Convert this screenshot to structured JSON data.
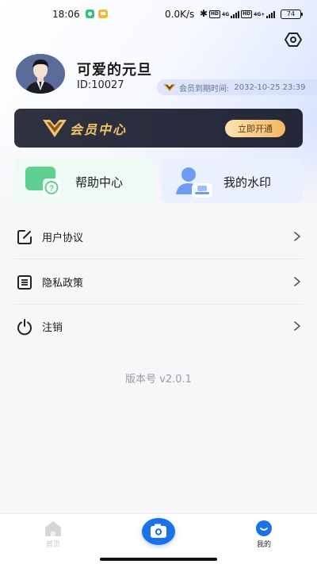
{
  "status_bar": {
    "time": "18:06",
    "network_speed": "0.0K/s",
    "bluetooth": "✱",
    "hd_label": "HD",
    "net_label_1": "4G",
    "net_label_2": "4G+",
    "battery": "74"
  },
  "profile": {
    "username": "可爱的元旦",
    "user_id": "ID:10027",
    "vip_expire_label": "会员到期时间:",
    "vip_expire_time": "2032-10-25 23:39"
  },
  "vip_banner": {
    "title": "会员中心",
    "open_button": "立即开通"
  },
  "quick_cards": {
    "help": "帮助中心",
    "watermark": "我的水印"
  },
  "menu": {
    "items": [
      {
        "label": "用户协议",
        "icon": "edit-document-icon"
      },
      {
        "label": "隐私政策",
        "icon": "list-document-icon"
      },
      {
        "label": "注销",
        "icon": "power-icon"
      }
    ]
  },
  "version": "版本号 v2.0.1",
  "tabbar": {
    "home": "首页",
    "camera": "camera-icon",
    "mine": "我的"
  },
  "colors": {
    "accent": "#1a72e8",
    "vip_gold": "#f2c56d",
    "vip_banner_bg": "#2a2d3c",
    "help_card_bg": "#eefaf4",
    "watermark_card_bg": "#eaf0fd"
  }
}
